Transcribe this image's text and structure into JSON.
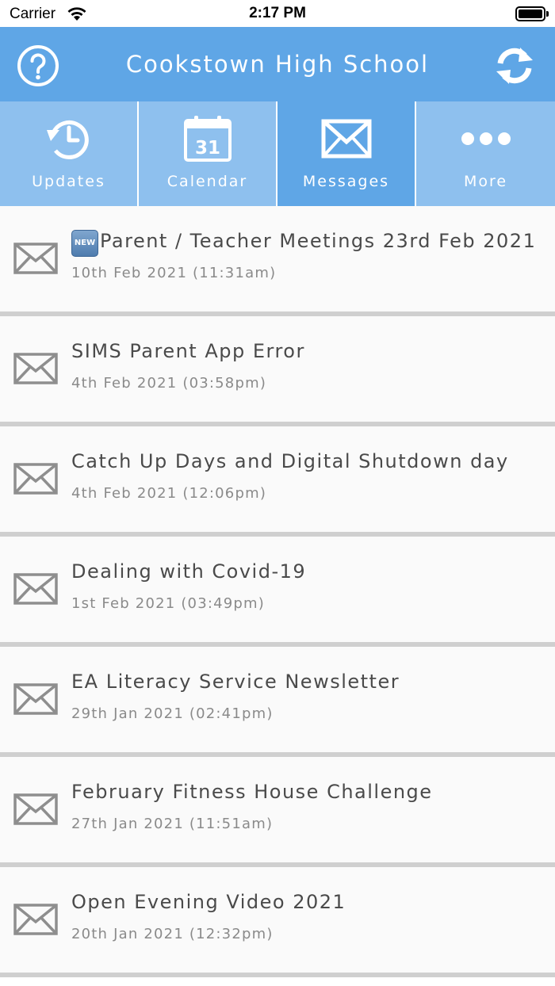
{
  "status_bar": {
    "carrier": "Carrier",
    "time": "2:17 PM"
  },
  "header": {
    "title": "Cookstown High School",
    "help_icon": "question-circle-icon",
    "refresh_icon": "refresh-icon",
    "background_color": "#5fa6e6"
  },
  "tabs": [
    {
      "label": "Updates",
      "icon": "clock-history-icon",
      "active": false
    },
    {
      "label": "Calendar",
      "icon": "calendar-icon",
      "calendar_day": "31",
      "active": false
    },
    {
      "label": "Messages",
      "icon": "envelope-icon",
      "active": true
    },
    {
      "label": "More",
      "icon": "ellipsis-icon",
      "active": false
    }
  ],
  "messages": [
    {
      "title": "Parent / Teacher Meetings 23rd Feb 2021",
      "date": "10th Feb 2021 (11:31am)",
      "badge": "NEW"
    },
    {
      "title": "SIMS Parent App Error",
      "date": "4th Feb 2021 (03:58pm)"
    },
    {
      "title": "Catch Up Days and Digital Shutdown day",
      "date": "4th Feb 2021 (12:06pm)"
    },
    {
      "title": "Dealing with Covid-19",
      "date": "1st Feb 2021 (03:49pm)"
    },
    {
      "title": "EA Literacy Service Newsletter",
      "date": "29th Jan 2021 (02:41pm)"
    },
    {
      "title": "February Fitness House Challenge",
      "date": "27th Jan 2021 (11:51am)"
    },
    {
      "title": "Open Evening Video 2021",
      "date": "20th Jan 2021 (12:32pm)"
    }
  ],
  "colors": {
    "tab_inactive": "#8ec0ee",
    "tab_active": "#5fa6e6",
    "title_text": "#4a4a4a",
    "date_text": "#8a8a8a",
    "divider": "#cfcfcf"
  }
}
